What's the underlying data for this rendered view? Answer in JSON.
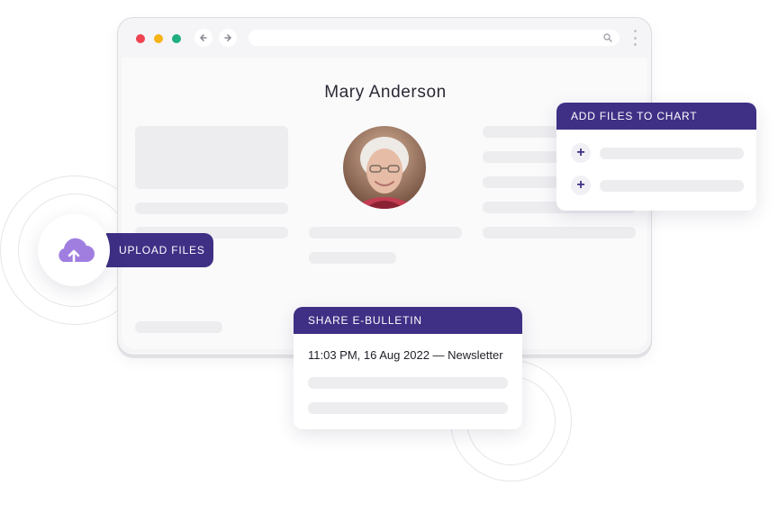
{
  "browser": {
    "controls": {
      "close_color": "#ee4452",
      "minimize_color": "#f5b315",
      "maximize_color": "#1fae80"
    },
    "back_icon": "arrow-left",
    "forward_icon": "arrow-right",
    "search_icon": "magnifier",
    "menu_icon": "vertical-dots"
  },
  "profile": {
    "name": "Mary Anderson"
  },
  "add_files_card": {
    "title": "ADD FILES TO CHART",
    "add_icon": "plus"
  },
  "upload": {
    "label": "UPLOAD FILES",
    "icon": "cloud-upload"
  },
  "bulletin_card": {
    "title": "SHARE E-BULLETIN",
    "entry": "11:03 PM, 16 Aug 2022 — Newsletter"
  },
  "colors": {
    "accent": "#3f2f85",
    "cloud": "#a07ee0",
    "placeholder": "#ededf0"
  }
}
